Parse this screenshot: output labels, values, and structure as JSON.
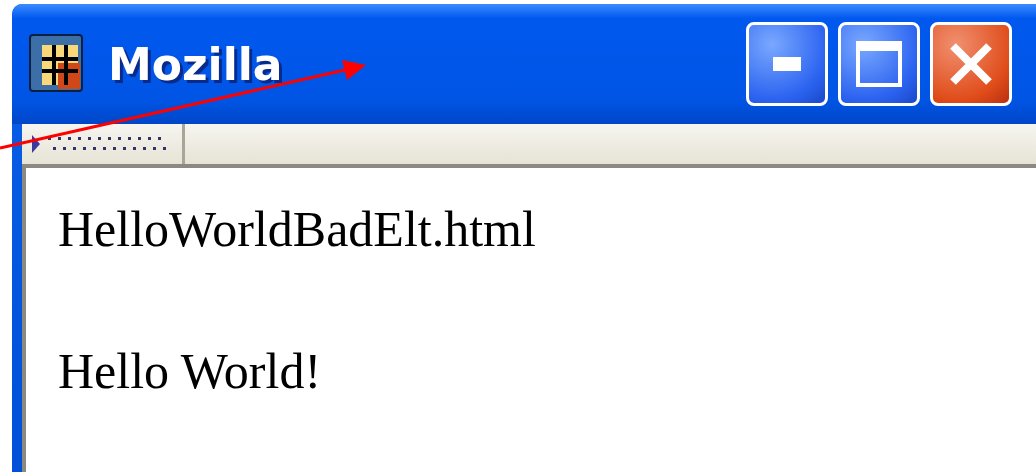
{
  "window": {
    "title": "Mozilla"
  },
  "content": {
    "lines": [
      "HelloWorldBadElt.html",
      "Hello World!"
    ]
  }
}
